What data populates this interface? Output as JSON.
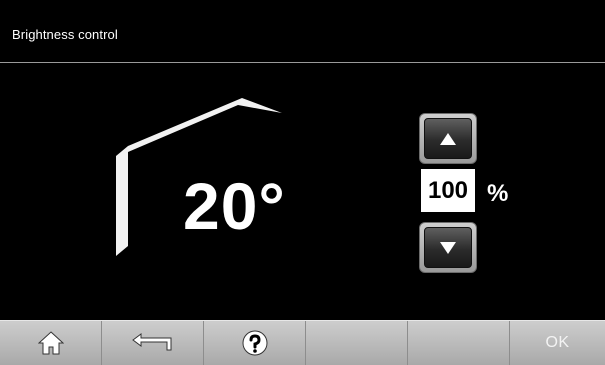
{
  "header": {
    "title": "Brightness control"
  },
  "main": {
    "temperature": "20°",
    "brightness": {
      "value": "100",
      "unit": "%"
    },
    "spinner": {
      "up_icon": "up-arrow-icon",
      "down_icon": "down-arrow-icon"
    }
  },
  "footer": {
    "buttons": [
      {
        "name": "home",
        "icon": "home-icon"
      },
      {
        "name": "back",
        "icon": "back-arrow-icon"
      },
      {
        "name": "help",
        "icon": "help-icon"
      },
      {
        "name": "empty-1",
        "icon": ""
      },
      {
        "name": "empty-2",
        "icon": ""
      },
      {
        "name": "ok",
        "label": "OK"
      }
    ]
  },
  "colors": {
    "background": "#000000",
    "footer": "#bdbdbd",
    "value_box": "#ffffff",
    "text": "#ffffff"
  }
}
